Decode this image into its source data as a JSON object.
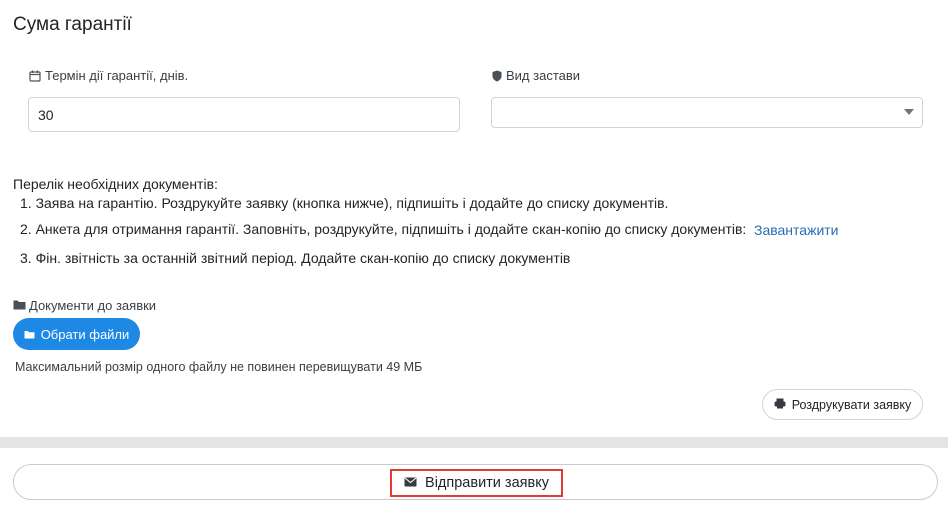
{
  "section": {
    "title": "Сума гарантії"
  },
  "term_field": {
    "label": "Термін дії гарантії, днів.",
    "value": "30"
  },
  "collateral_field": {
    "label": "Вид застави",
    "selected": ""
  },
  "documents": {
    "intro": "Перелік необхідних документів:",
    "items": [
      "1. Заява на гарантію. Роздрукуйте заявку (кнопка нижче), підпишіть і додайте до списку документів.",
      "2. Анкета для отримання гарантії. Заповніть, роздрукуйте, підпишіть і додайте скан-копію до списку документів:",
      "3. Фін. звітність за останній звітний період. Додайте скан-копію до списку документів"
    ],
    "download_link": "Завантажити"
  },
  "attachments": {
    "label": "Документи до заявки",
    "choose_button": "Обрати файли",
    "max_size_note": "Максимальний розмір одного файлу не повинен перевищувати 49 МБ"
  },
  "print_button": "Роздрукувати заявку",
  "submit_button": "Відправити заявку",
  "icons": {
    "term": "calendar-icon",
    "collateral": "shield-icon",
    "attachments": "folder-icon",
    "choose": "folder-icon",
    "print": "printer-icon",
    "submit": "envelope-icon"
  },
  "colors": {
    "primary_button": "#1e88e5",
    "link": "#2a6db5",
    "highlight_border": "#e53935"
  }
}
